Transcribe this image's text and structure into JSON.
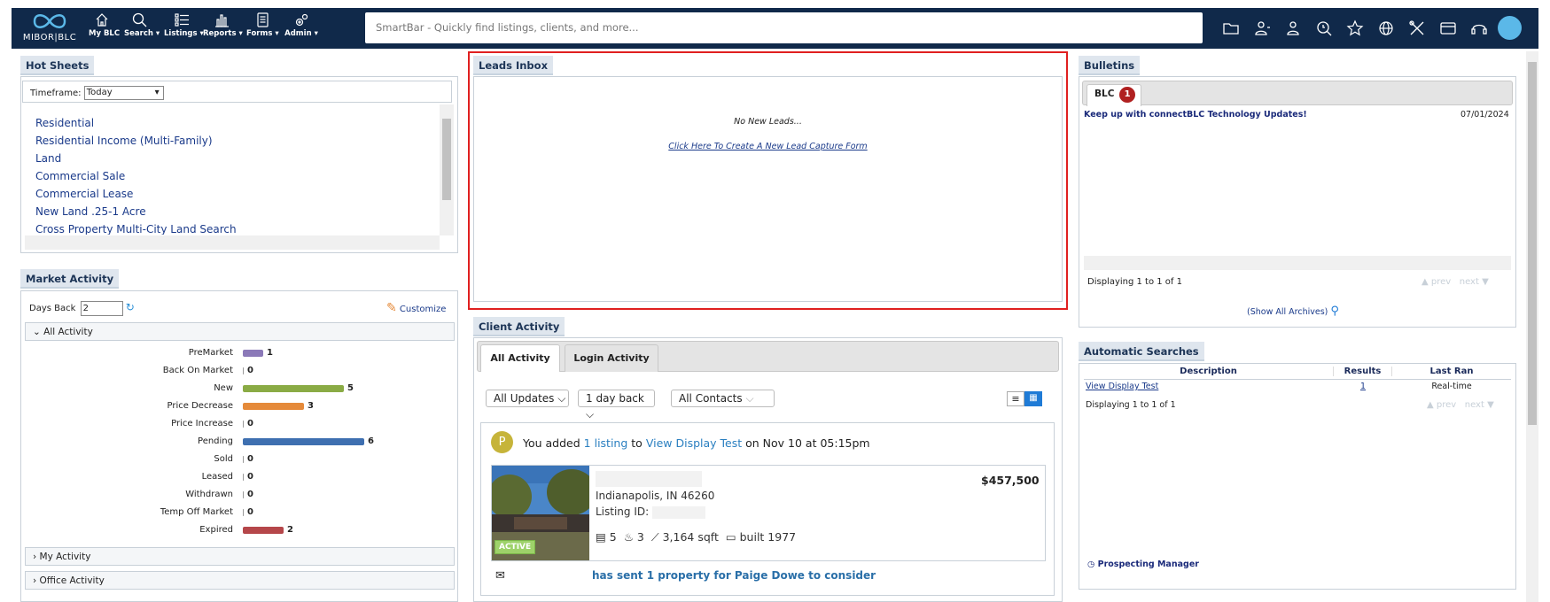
{
  "nav": {
    "logo_text": "MIBOR|BLC",
    "items": [
      {
        "label": "My BLC",
        "icon": "home-icon"
      },
      {
        "label": "Search ▾",
        "icon": "search-icon"
      },
      {
        "label": "Listings ▾",
        "icon": "list-icon"
      },
      {
        "label": "Reports ▾",
        "icon": "bar-chart-icon"
      },
      {
        "label": "Forms ▾",
        "icon": "document-icon"
      },
      {
        "label": "Admin ▾",
        "icon": "gears-icon"
      }
    ],
    "smartbar_placeholder": "SmartBar - Quickly find listings, clients, and more...",
    "right_icons": [
      "folder-icon",
      "contacts-icon",
      "person-icon",
      "magnify-clock-icon",
      "star-icon",
      "globe-icon",
      "tools-icon",
      "card-icon",
      "support-icon"
    ]
  },
  "hot_sheets": {
    "title": "Hot Sheets",
    "timeframe_label": "Timeframe:",
    "timeframe_value": "Today",
    "items": [
      "Residential",
      "Residential Income (Multi-Family)",
      "Land",
      "Commercial Sale",
      "Commercial Lease",
      "New Land .25-1 Acre",
      "Cross Property Multi-City Land Search"
    ]
  },
  "market_activity": {
    "title": "Market Activity",
    "days_back_label": "Days Back",
    "days_back_value": "2",
    "customize_label": "Customize",
    "all_activity_label": "All Activity",
    "rows": [
      {
        "label": "PreMarket",
        "value": "1",
        "color": "#8b79b8"
      },
      {
        "label": "Back On Market",
        "value": "0",
        "color": "#999999"
      },
      {
        "label": "New",
        "value": "5",
        "color": "#8aab45"
      },
      {
        "label": "Price Decrease",
        "value": "3",
        "color": "#e58a3a"
      },
      {
        "label": "Price Increase",
        "value": "0",
        "color": "#999999"
      },
      {
        "label": "Pending",
        "value": "6",
        "color": "#3e6fb0"
      },
      {
        "label": "Sold",
        "value": "0",
        "color": "#999999"
      },
      {
        "label": "Leased",
        "value": "0",
        "color": "#999999"
      },
      {
        "label": "Withdrawn",
        "value": "0",
        "color": "#999999"
      },
      {
        "label": "Temp Off Market",
        "value": "0",
        "color": "#999999"
      },
      {
        "label": "Expired",
        "value": "2",
        "color": "#b5474a"
      }
    ],
    "my_activity_label": "My Activity",
    "office_activity_label": "Office Activity"
  },
  "leads_inbox": {
    "title": "Leads Inbox",
    "empty_text": "No New Leads...",
    "create_link": "Click Here To Create A New Lead Capture Form"
  },
  "client_activity": {
    "title": "Client Activity",
    "tabs": [
      "All Activity",
      "Login Activity"
    ],
    "filter_updates": "All Updates",
    "filter_days": "1 day back",
    "filter_contacts": "All Contacts",
    "activity_avatar": "P",
    "activity_prefix": "You added",
    "activity_count_link": "1 listing",
    "activity_to": "to",
    "activity_search_link": "View Display Test",
    "activity_suffix": "on Nov 10 at 05:15pm",
    "listing": {
      "price": "$457,500",
      "city": "Indianapolis, IN 46260",
      "id_label": "Listing ID:",
      "status": "ACTIVE",
      "beds": "5",
      "baths": "3",
      "sqft": "3,164 sqft",
      "built": "built 1977"
    },
    "sent_text": "has sent 1 property for Paige Dowe to consider"
  },
  "bulletins": {
    "title": "Bulletins",
    "tab_label": "BLC",
    "tab_badge": "1",
    "item_title": "Keep up with connectBLC Technology Updates!",
    "item_date": "07/01/2024",
    "displaying": "Displaying 1 to 1 of 1",
    "prev": "▲ prev",
    "next": "next ▼",
    "archives_link": "(Show All Archives)"
  },
  "auto_searches": {
    "title": "Automatic Searches",
    "headers": [
      "Description",
      "Results",
      "Last Ran"
    ],
    "rows": [
      {
        "description": "View Display Test",
        "results": "1",
        "last_ran": "Real-time"
      }
    ],
    "displaying": "Displaying 1 to 1 of 1",
    "prev": "▲ prev",
    "next": "next ▼",
    "prospecting_link": "Prospecting Manager"
  }
}
